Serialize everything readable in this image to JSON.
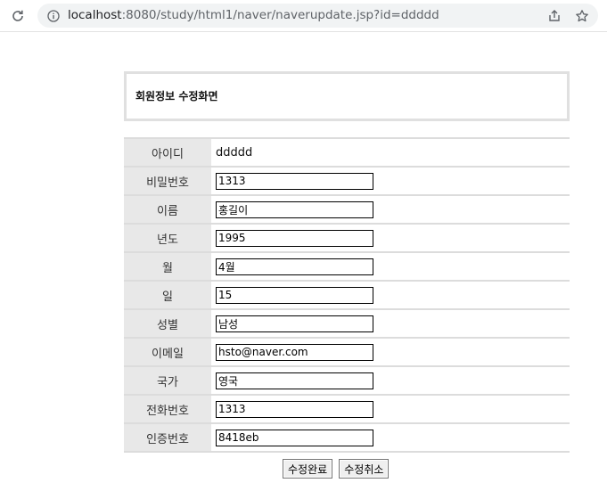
{
  "browser": {
    "url_host": "localhost",
    "url_rest": ":8080/study/html1/naver/naverupdate.jsp?id=ddddd",
    "icons": [
      "reload-icon",
      "info-icon",
      "share-icon",
      "star-icon"
    ]
  },
  "page": {
    "title": "회원정보 수정화면"
  },
  "form": {
    "rows": [
      {
        "label": "아이디",
        "value": "ddddd"
      },
      {
        "label": "비밀번호",
        "value": "1313"
      },
      {
        "label": "이름",
        "value": "홍길이"
      },
      {
        "label": "년도",
        "value": "1995"
      },
      {
        "label": "월",
        "value": "4월"
      },
      {
        "label": "일",
        "value": "15"
      },
      {
        "label": "성별",
        "value": "남성"
      },
      {
        "label": "이메일",
        "value": "hsto@naver.com"
      },
      {
        "label": "국가",
        "value": "영국"
      },
      {
        "label": "전화번호",
        "value": "1313"
      },
      {
        "label": "인증번호",
        "value": "8418eb"
      }
    ]
  },
  "buttons": {
    "submit": "수정완료",
    "cancel": "수정취소"
  }
}
